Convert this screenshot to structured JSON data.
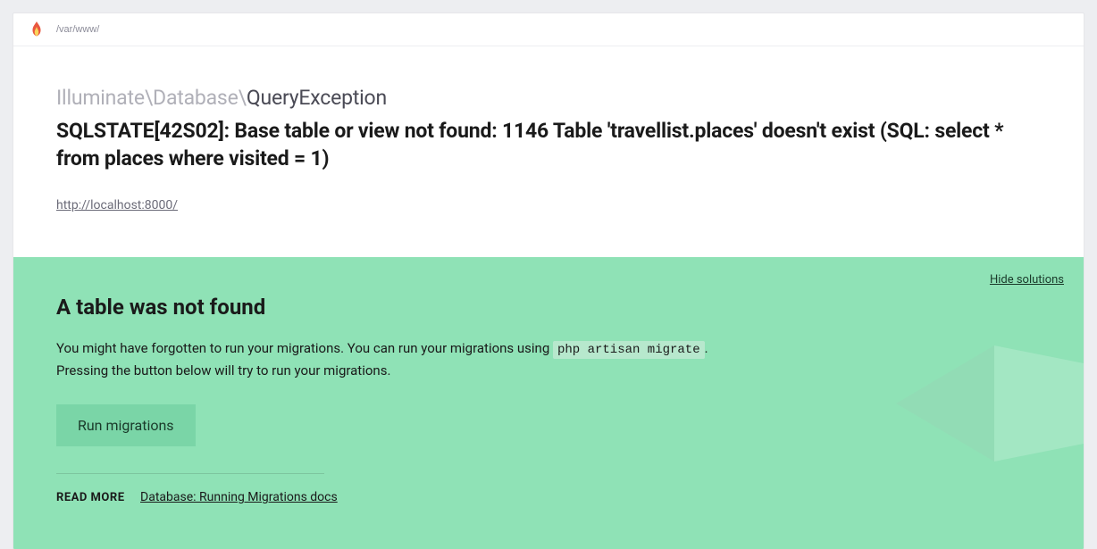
{
  "header": {
    "path": "/var/www/"
  },
  "error": {
    "namespace": "Illuminate\\Database\\",
    "exception_name": "QueryException",
    "message": "SQLSTATE[42S02]: Base table or view not found: 1146 Table 'travellist.places' doesn't exist (SQL: select * from places where visited = 1)",
    "url": "http://localhost:8000/"
  },
  "solution": {
    "hide_label": "Hide solutions",
    "title": "A table was not found",
    "desc_line1_pre": "You might have forgotten to run your migrations. You can run your migrations using ",
    "desc_code": "php artisan migrate",
    "desc_line1_post": ".",
    "desc_line2": "Pressing the button below will try to run your migrations.",
    "button_label": "Run migrations",
    "read_more_label": "READ MORE",
    "docs_link_text": "Database: Running Migrations docs"
  }
}
